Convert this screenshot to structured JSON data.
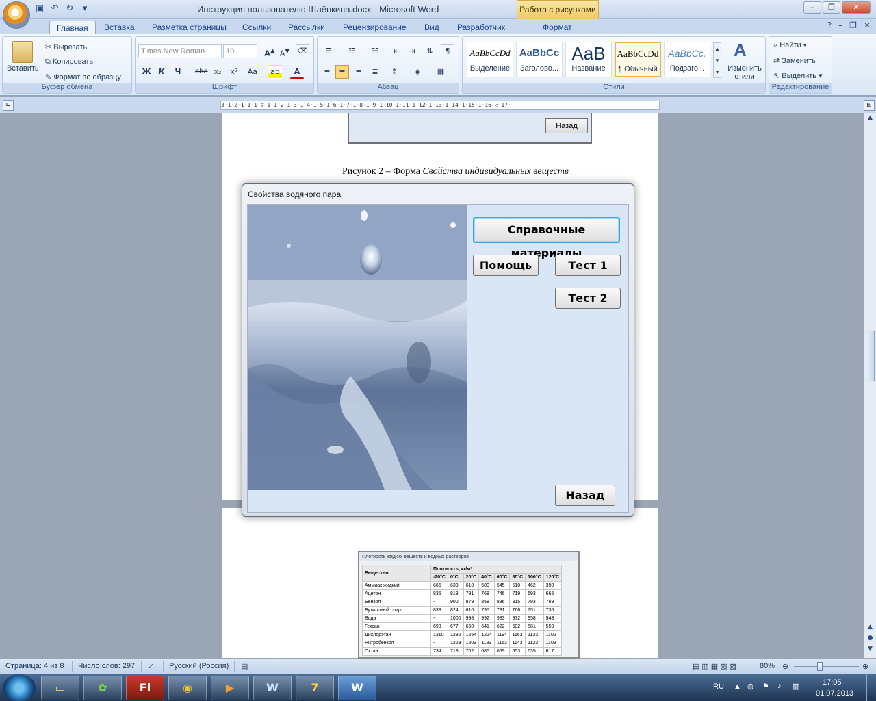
{
  "window": {
    "title": "Инструкция пользователю Шлёнкина.docx - Microsoft Word",
    "context_tab": "Работа с рисунками"
  },
  "ribbon_tabs": [
    "Главная",
    "Вставка",
    "Разметка страницы",
    "Ссылки",
    "Рассылки",
    "Рецензирование",
    "Вид",
    "Разработчик",
    "Формат"
  ],
  "clipboard": {
    "paste": "Вставить",
    "cut": "Вырезать",
    "copy": "Копировать",
    "format_painter": "Формат по образцу",
    "label": "Буфер обмена"
  },
  "font": {
    "name": "Times New Roman",
    "size": "10",
    "bold": "Ж",
    "italic": "К",
    "underline": "Ч",
    "strike": "abe",
    "sub": "x₂",
    "sup": "x²",
    "case": "Aa",
    "label": "Шрифт"
  },
  "paragraph": {
    "label": "Абзац"
  },
  "styles": {
    "items": [
      {
        "sample": "AaBbCcDd",
        "name": "Выделение"
      },
      {
        "sample": "AaBbCc",
        "name": "Заголово..."
      },
      {
        "sample": "AaB",
        "name": "Название"
      },
      {
        "sample": "AaBbCcDd",
        "name": "¶ Обычный"
      },
      {
        "sample": "AaBbCc.",
        "name": "Подзаго..."
      }
    ],
    "change": "Изменить стили",
    "label": "Стили"
  },
  "editing": {
    "find": "Найти",
    "replace": "Заменить",
    "select": "Выделить",
    "label": "Редактирование"
  },
  "ruler": "3·1·2·1·1·1·▽·1·1·2·1·3·1·4·1·5·1·6·1·7·1·8·1·9·1·10·1·11·1·12·1·13·1·14·1·15·1·16·◁·17·",
  "document": {
    "top_fragment_back": "Назад",
    "caption_prefix": "Рисунок 2 – Форма ",
    "caption_italic": "Свойства индивидуальных веществ"
  },
  "dialog": {
    "title": "Свойства водяного пара",
    "btn_reference": "Справочные материалы",
    "btn_help": "Помощь",
    "btn_test1": "Тест 1",
    "btn_test2": "Тест 2",
    "btn_back": "Назад"
  },
  "table_shot": {
    "title": "Плотность жидких веществ и водных растворов",
    "header_substance": "Вещество",
    "header_density": "Плотность, кг/м³",
    "temps": [
      "-20°C",
      "0°C",
      "20°C",
      "40°C",
      "60°C",
      "80°C",
      "100°C",
      "120°C"
    ],
    "rows": [
      [
        "Аммиак жидкий",
        "665",
        "639",
        "610",
        "580",
        "545",
        "510",
        "462",
        "390"
      ],
      [
        "Ацетон",
        "835",
        "813",
        "791",
        "768",
        "746",
        "719",
        "693",
        "665"
      ],
      [
        "Бензол",
        "-",
        "900",
        "879",
        "858",
        "836",
        "815",
        "793",
        "769"
      ],
      [
        "Бутиловый спирт",
        "838",
        "824",
        "810",
        "795",
        "781",
        "766",
        "751",
        "735"
      ],
      [
        "Вода",
        "-",
        "1000",
        "998",
        "992",
        "983",
        "972",
        "958",
        "943"
      ],
      [
        "Гексан",
        "693",
        "677",
        "660",
        "641",
        "622",
        "602",
        "581",
        "559"
      ],
      [
        "Дихлорэтан",
        "1310",
        "1282",
        "1254",
        "1224",
        "1194",
        "1163",
        "1133",
        "1102"
      ],
      [
        "Нитробензол",
        "-",
        "1223",
        "1203",
        "1183",
        "1163",
        "1143",
        "1123",
        "1103"
      ],
      [
        "Октан",
        "734",
        "718",
        "702",
        "686",
        "669",
        "653",
        "635",
        "617"
      ]
    ]
  },
  "status": {
    "page": "Страница: 4 из 8",
    "words": "Число слов: 297",
    "language": "Русский (Россия)",
    "zoom": "80%"
  },
  "taskbar": {
    "lang": "RU",
    "time": "17:05",
    "date": "01.07.2013"
  }
}
